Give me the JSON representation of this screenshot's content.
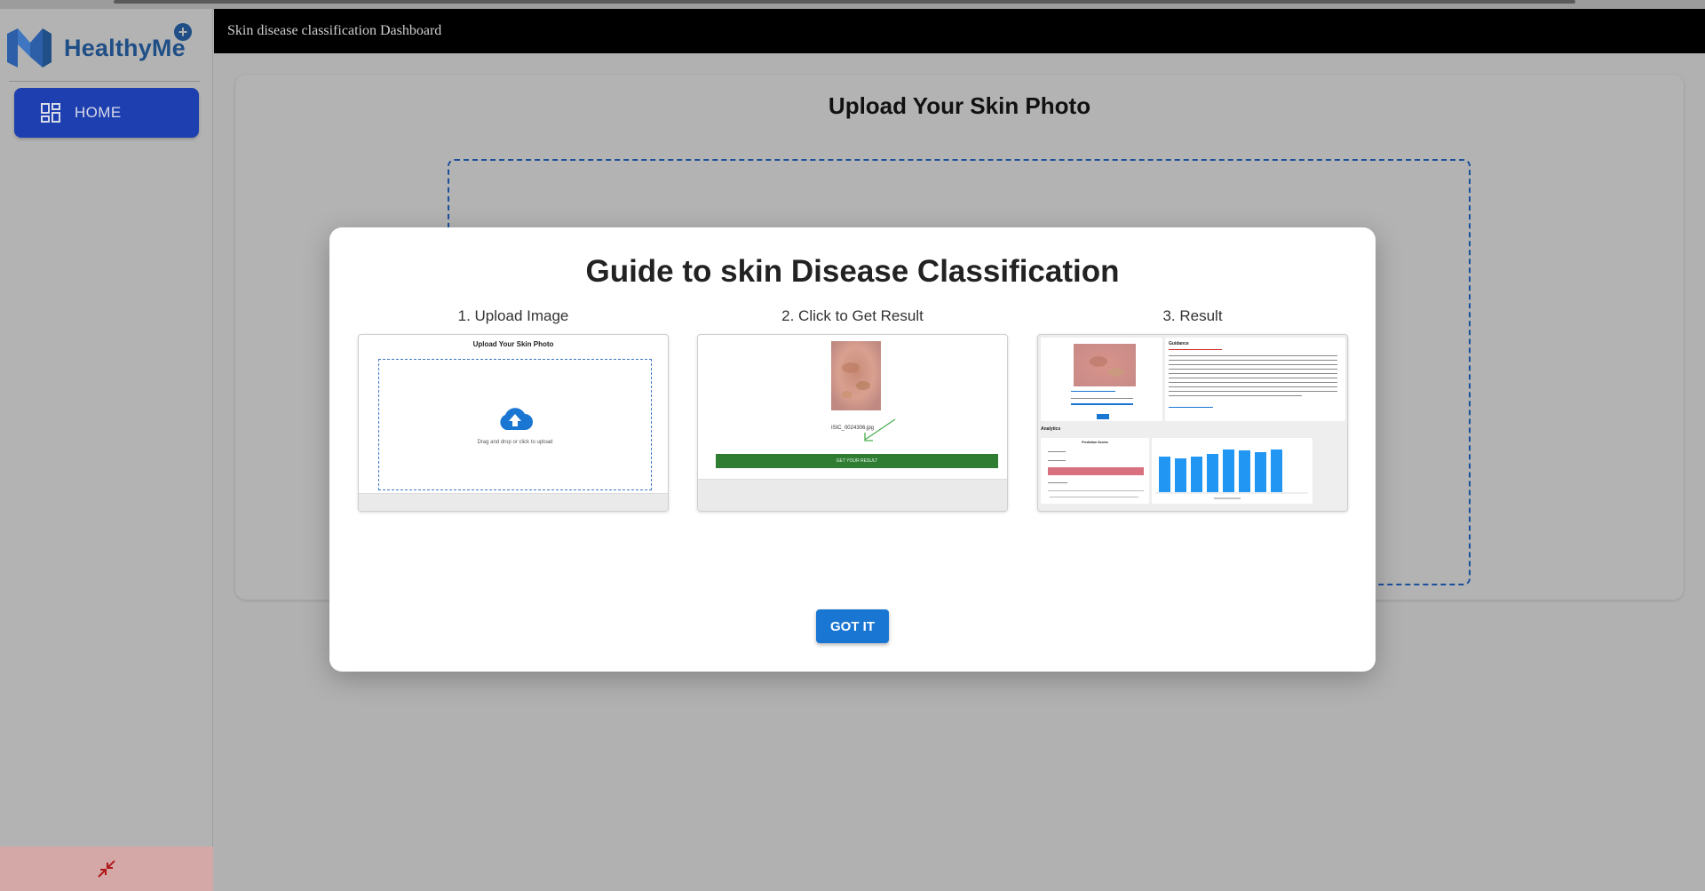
{
  "app": {
    "logo_text": "HealthyMe",
    "header_title": "Skin disease classification Dashboard"
  },
  "sidebar": {
    "items": [
      {
        "label": "HOME",
        "icon": "dashboard-icon"
      }
    ],
    "footer_icon": "collapse-arrows-icon"
  },
  "main": {
    "upload_title": "Upload Your Skin Photo"
  },
  "modal": {
    "title": "Guide to skin Disease Classification",
    "steps": [
      {
        "label": "1. Upload Image",
        "thumb_title": "Upload Your Skin Photo",
        "thumb_text": "Drag and drop or click to upload"
      },
      {
        "label": "2. Click to Get Result",
        "thumb_file": "ISIC_0024306.jpg",
        "thumb_button": "GET YOUR RESULT"
      },
      {
        "label": "3. Result",
        "thumb_heading": "Guidance",
        "thumb_analytics": "Analytics",
        "thumb_chart_title": "Prediction Scores"
      }
    ],
    "confirm_label": "GOT IT"
  },
  "colors": {
    "accent": "#1976d2",
    "nav_active": "#1e3fb0",
    "brand": "#1f4f86",
    "header_bg": "#000000",
    "dropzone_border": "#1a4f9c",
    "result_button": "#2e7d32"
  }
}
